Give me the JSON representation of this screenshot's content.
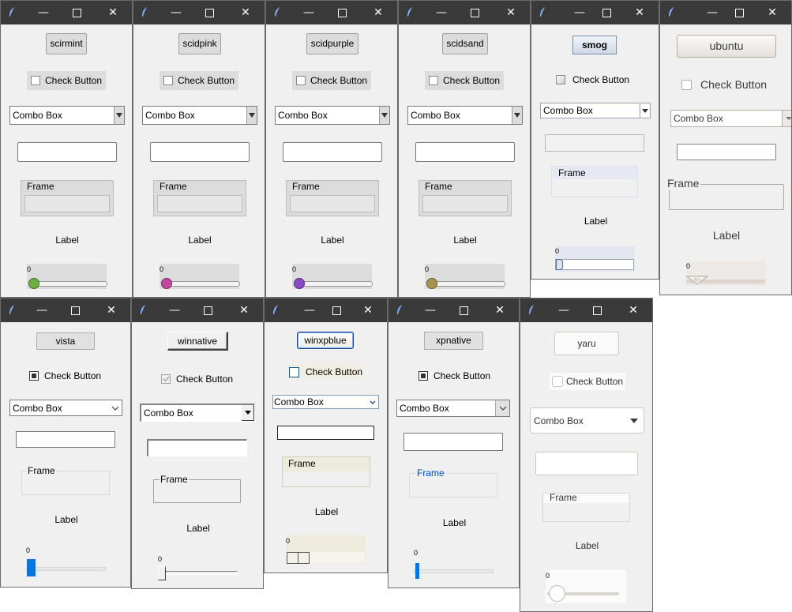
{
  "themes": [
    "scirmint",
    "scidpink",
    "scidpurple",
    "scidsand",
    "smog",
    "ubuntu",
    "vista",
    "winnative",
    "winxpblue",
    "xpnative",
    "yaru"
  ],
  "widgets": {
    "check": "Check Button",
    "combo": "Combo Box",
    "frame": "Frame",
    "label": "Label",
    "scale_value": "0"
  },
  "titlebar": {
    "minimize_glyph": "—",
    "close_glyph": "✕"
  },
  "accents": {
    "scirmint": "#6cb043",
    "scidpink": "#c04a9c",
    "scidpurple": "#8a4cc4",
    "scidsand": "#a89450",
    "vista": "#0a74da",
    "xpnative": "#0a74da"
  }
}
